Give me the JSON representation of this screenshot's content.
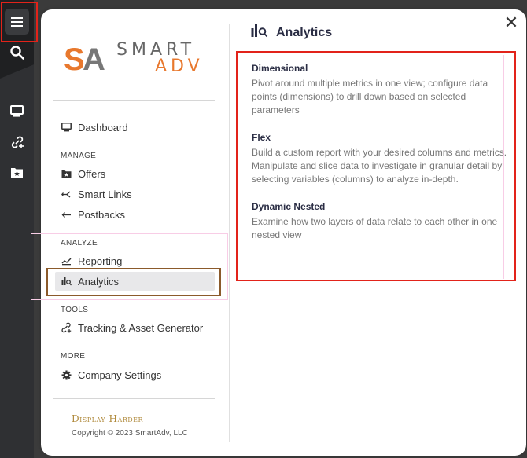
{
  "rail": {
    "icons": [
      "hamburger-menu-icon",
      "search-icon",
      "monitor-icon",
      "link-plus-icon",
      "star-folder-icon"
    ]
  },
  "logo": {
    "mark": "SA",
    "word1": "SMART",
    "word2": "ADV"
  },
  "nav": {
    "dashboard": "Dashboard",
    "sections": {
      "manage": "MANAGE",
      "analyze": "ANALYZE",
      "tools": "TOOLS",
      "more": "MORE"
    },
    "offers": "Offers",
    "smart_links": "Smart Links",
    "postbacks": "Postbacks",
    "reporting": "Reporting",
    "analytics": "Analytics",
    "tracking": "Tracking & Asset Generator",
    "company_settings": "Company Settings"
  },
  "footer": {
    "title": "Display Harder",
    "copyright": "Copyright © 2023 SmartAdv, LLC"
  },
  "content": {
    "header": "Analytics",
    "features": [
      {
        "title": "Dimensional",
        "desc": "Pivot around multiple metrics in one view; configure data points (dimensions) to drill down based on selected parameters"
      },
      {
        "title": "Flex",
        "desc": "Build a custom report with your desired columns and metrics. Manipulate and slice data to investigate in granular detail by selecting variables (columns) to analyze in-depth."
      },
      {
        "title": "Dynamic Nested",
        "desc": "Examine how two layers of data relate to each other in one nested view"
      }
    ]
  },
  "colors": {
    "accent_orange": "#e8782d",
    "logo_gray": "#888888",
    "highlight_red": "#e2231a",
    "active_border": "#8b5a2b",
    "footer_gold": "#b08a3c"
  }
}
